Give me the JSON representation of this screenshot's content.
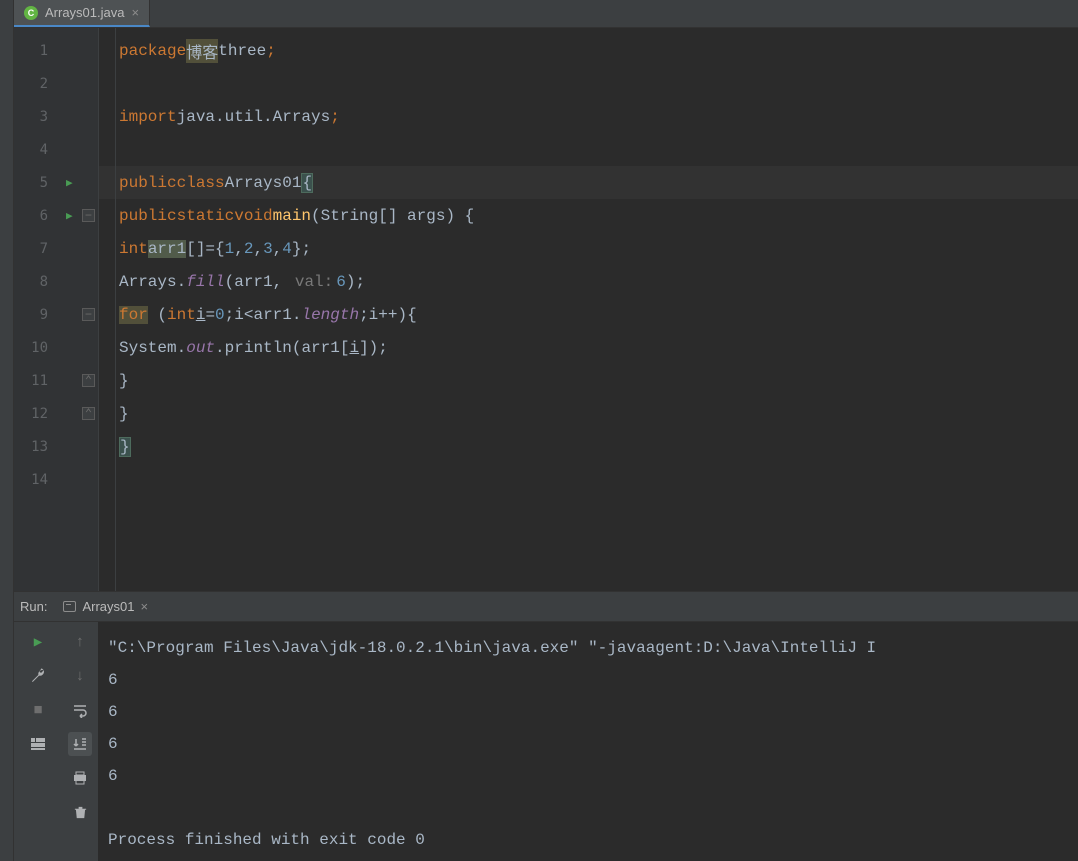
{
  "tab": {
    "filename": "Arrays01.java",
    "icon_letter": "C"
  },
  "gutter": {
    "lines": [
      1,
      2,
      3,
      4,
      5,
      6,
      7,
      8,
      9,
      10,
      11,
      12,
      13,
      14
    ],
    "run_marks": [
      5,
      6
    ],
    "fold_open": [
      6,
      9
    ],
    "fold_close": [
      11,
      12
    ]
  },
  "code": {
    "l1": {
      "kw": "package",
      "pkg_hl": "博客",
      "pkg_rest": "three",
      "semi": ";"
    },
    "l3": {
      "kw": "import",
      "path": "java.util.Arrays",
      "semi": ";"
    },
    "l5": {
      "kw1": "public",
      "kw2": "class",
      "name": "Arrays01",
      "brace": "{"
    },
    "l6": {
      "kw1": "public",
      "kw2": "static",
      "kw3": "void",
      "fn": "main",
      "params": "(String[] args) {"
    },
    "l7": {
      "kw": "int",
      "var": "arr1",
      "decl": "[]={",
      "n1": "1",
      "n2": "2",
      "n3": "3",
      "n4": "4",
      "end": "};"
    },
    "l8": {
      "cls": "Arrays.",
      "fn": "fill",
      "open": "(arr1, ",
      "hint": "val:",
      "val": "6",
      "close": ");"
    },
    "l9": {
      "kw": "for",
      "open": " (",
      "kw2": "int",
      "var": "i",
      "eq": "=",
      "z": "0",
      "mid": ";i<arr1.",
      "len": "length",
      "next": ";i++){"
    },
    "l10": {
      "sys": "System.",
      "out": "out",
      "call": ".println(arr1[",
      "idx": "i",
      "end": "]);"
    },
    "l11": {
      "brace": "}"
    },
    "l12": {
      "brace": "}"
    },
    "l13": {
      "brace": "}"
    }
  },
  "run": {
    "label": "Run:",
    "config": "Arrays01",
    "output": {
      "cmd": "\"C:\\Program Files\\Java\\jdk-18.0.2.1\\bin\\java.exe\" \"-javaagent:D:\\Java\\IntelliJ I",
      "l1": "6",
      "l2": "6",
      "l3": "6",
      "l4": "6",
      "exit": "Process finished with exit code 0"
    }
  },
  "icons": {
    "rerun": "▶",
    "wrench": "wrench",
    "stop": "■",
    "layout": "layout",
    "up": "↑",
    "down": "↓",
    "soft_wrap": "↩",
    "scroll": "scroll",
    "print": "print",
    "trash": "trash"
  }
}
